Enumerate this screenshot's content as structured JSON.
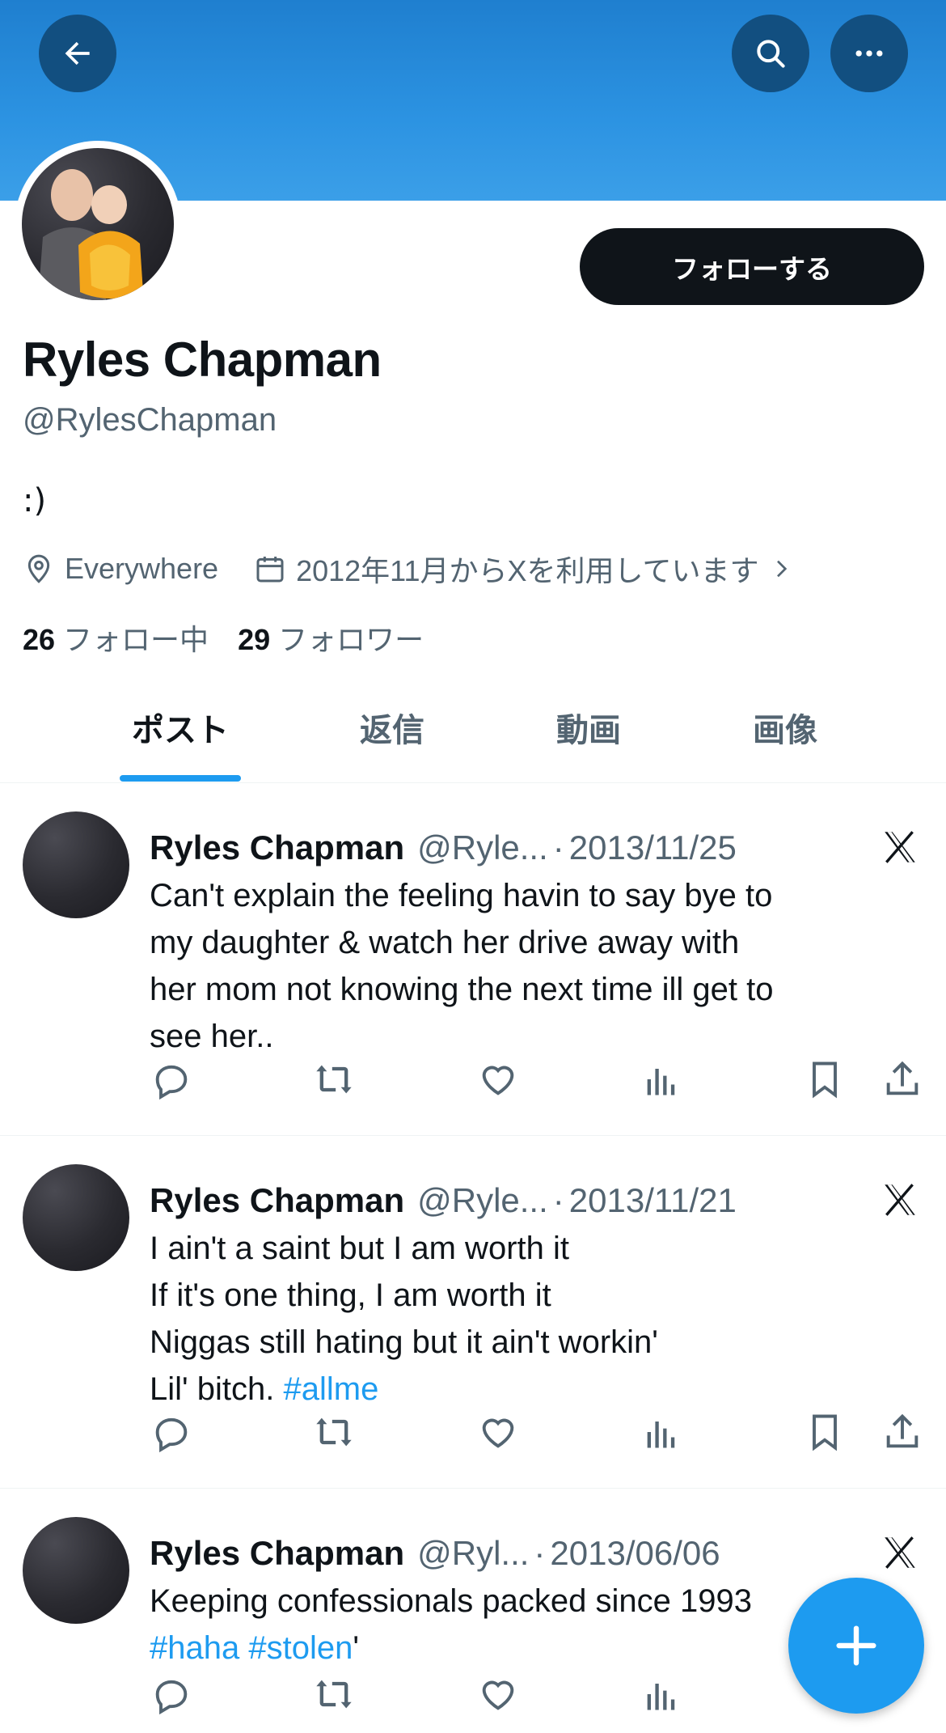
{
  "header": {
    "back_icon": "arrow-left-icon",
    "search_icon": "search-icon",
    "more_icon": "ellipsis-icon",
    "banner_color": "#2c93e2"
  },
  "profile": {
    "follow_label": "フォローする",
    "display_name": "Ryles Chapman",
    "handle": "@RylesChapman",
    "bio": ":)",
    "location": "Everywhere",
    "joined": "2012年11月からXを利用しています",
    "following_count": "26",
    "following_label": "フォロー中",
    "followers_count": "29",
    "followers_label": "フォロワー"
  },
  "tabs": [
    {
      "label": "ポスト",
      "active": true
    },
    {
      "label": "返信",
      "active": false
    },
    {
      "label": "動画",
      "active": false
    },
    {
      "label": "画像",
      "active": false
    }
  ],
  "tweets": [
    {
      "name": "Ryles Chapman",
      "handle": "@Ryle...",
      "dot": "·",
      "date": "2013/11/25",
      "lines": [
        "Can't explain the feeling havin to say bye to",
        "my daughter & watch her drive away with",
        "her mom not knowing the next time ill get to",
        "see her.."
      ]
    },
    {
      "name": "Ryles Chapman",
      "handle": "@Ryle...",
      "dot": "·",
      "date": "2013/11/21",
      "lines": [
        "I ain't a saint but I am worth it",
        "If it's one thing, I am worth it",
        "Niggas still hating but it ain't workin'"
      ],
      "last_line_text": "Lil' bitch. ",
      "last_line_hashtag": "#allme"
    },
    {
      "name": "Ryles Chapman",
      "handle": "@Ryl...",
      "dot": "·",
      "date": "2013/06/06",
      "line1": "Keeping confessionals packed since 1993",
      "hashtag1": "#haha",
      "hashtag2": "#stolen",
      "trail": "'"
    }
  ],
  "actions": {
    "reply_icon": "reply-icon",
    "repost_icon": "repost-icon",
    "like_icon": "heart-icon",
    "views_icon": "views-icon",
    "bookmark_icon": "bookmark-icon",
    "share_icon": "share-icon"
  },
  "fab": {
    "icon": "plus-icon",
    "color": "#1d9bf0"
  }
}
